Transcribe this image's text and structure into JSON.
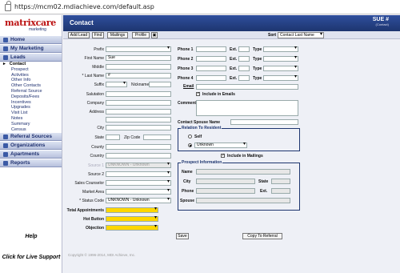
{
  "browser": {
    "url": "https://mcm02.mdiachieve.com/default.asp"
  },
  "logo": {
    "name": "matrixcare",
    "tagline": "marketing"
  },
  "sidebar": {
    "home": "Home",
    "my_marketing": "My Marketing",
    "leads": "Leads",
    "lead_items": [
      "Contact",
      "Prospect",
      "Activities",
      "Other Info",
      "Other Contacts",
      "Referral Source",
      "Deposits/Fees",
      "Incentives",
      "Upgrades",
      "Visit List",
      "Notes",
      "Summary",
      "Census"
    ],
    "referral_sources": "Referral Sources",
    "organizations": "Organizations",
    "apartments": "Apartments",
    "reports": "Reports",
    "help": "Help",
    "live_support": "Click for Live Support"
  },
  "header": {
    "title": "Contact",
    "user": "SUE #",
    "user_sub": "(Contact)"
  },
  "toolbar": {
    "add_lead": "Add Lead",
    "find": "Find",
    "mailings": "Mailings",
    "profile": "Profile",
    "sort_label": "Sort",
    "sort_value": "Contact Last Name"
  },
  "form": {
    "prefix": "Prefix",
    "first_name": "First Name",
    "first_name_value": "Sue",
    "middle": "Middle",
    "last_name": "* Last Name",
    "last_name_value": "#",
    "suffix": "Suffix",
    "nickname": "Nickname",
    "salutation": "Salutation",
    "company": "Company",
    "address": "Address",
    "city": "City",
    "state": "State",
    "zip": "Zip Code",
    "county": "County",
    "country": "Country",
    "source1": "Source 1",
    "source1_value": "UNKNOWN - Unknown",
    "source2": "Source 2",
    "sales_counselor": "Sales Counselor",
    "market_area": "Market Area",
    "status_code": "* Status Code",
    "status_value": "UNKNOWN - Unknown",
    "total_appts": "Total Appointments",
    "hot_button": "Hot Button",
    "objection": "Objection",
    "phone1": "Phone 1",
    "phone2": "Phone 2",
    "phone3": "Phone 3",
    "phone4": "Phone 4",
    "ext": "Ext.",
    "type": "Type",
    "email": "Email",
    "include_emails": "Include in Emails",
    "comment": "Comment",
    "spouse_name": "Contact Spouse Name",
    "relation_group": "Relation To Resident",
    "self": "Self",
    "relation_value": "Unknown",
    "include_mailings": "Include in Mailings",
    "prospect_group": "Prospect Information",
    "p_name": "Name",
    "p_city": "City",
    "p_state": "State",
    "p_phone": "Phone",
    "p_ext": "Ext.",
    "p_spouse": "Spouse",
    "save": "Save",
    "copy_referral": "Copy To Referral"
  },
  "footer": {
    "copyright": "Copyright © 1996-2014, MDI Achieve, Inc."
  },
  "colors": {
    "header": "#1d356f",
    "accent": "#ffd700"
  }
}
